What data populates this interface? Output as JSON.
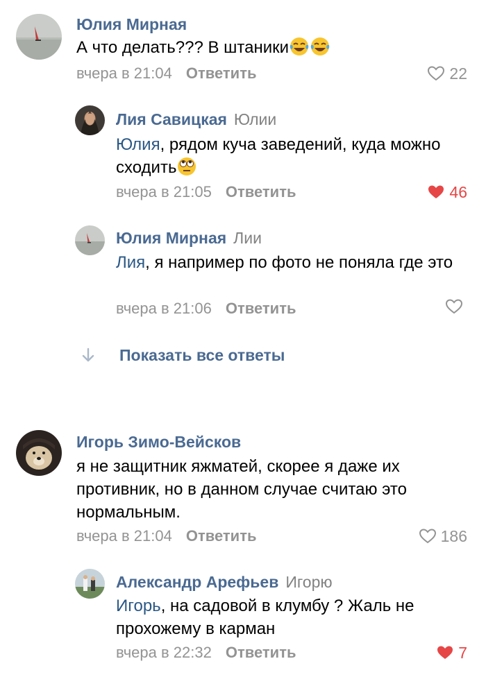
{
  "comments": [
    {
      "author": "Юлия Мирная",
      "text": "А что делать???  В штаники",
      "time": "вчера в 21:04",
      "reply_label": "Ответить",
      "likes": "22",
      "liked": false,
      "emojis": [
        "tears-of-joy-emoji",
        "tears-of-joy-emoji"
      ]
    },
    {
      "author": "Лия Савицкая",
      "reply_to": "Юлии",
      "mention": "Юлия",
      "text": ", рядом куча заведений, куда можно сходить",
      "time": "вчера в 21:05",
      "reply_label": "Ответить",
      "likes": "46",
      "liked": true,
      "emojis": [
        "eye-roll-emoji"
      ]
    },
    {
      "author": "Юлия Мирная",
      "reply_to": "Лии",
      "mention": "Лия",
      "text": ", я например по фото не поняла где это",
      "time": "вчера в 21:06",
      "reply_label": "Ответить",
      "likes": "",
      "liked": false
    },
    {
      "author": "Игорь Зимо-Вейсков",
      "text": "я не защитник яжматей, скорее я даже их противник, но в данном случае считаю это нормальным.",
      "time": "вчера в 21:04",
      "reply_label": "Ответить",
      "likes": "186",
      "liked": false
    },
    {
      "author": "Александр Арефьев",
      "reply_to": "Игорю",
      "mention": "Игорь",
      "text": ", на садовой в клумбу ? Жаль не прохожему в карман",
      "time": "вчера в 22:32",
      "reply_label": "Ответить",
      "likes": "7",
      "liked": true
    }
  ],
  "show_all_replies": "Показать все ответы",
  "icons": {
    "like": "heart-icon",
    "show_all": "arrow-down-icon"
  },
  "colors": {
    "author": "#4a6a92",
    "mention": "#2a5885",
    "meta": "#939393",
    "liked": "#e64646"
  }
}
